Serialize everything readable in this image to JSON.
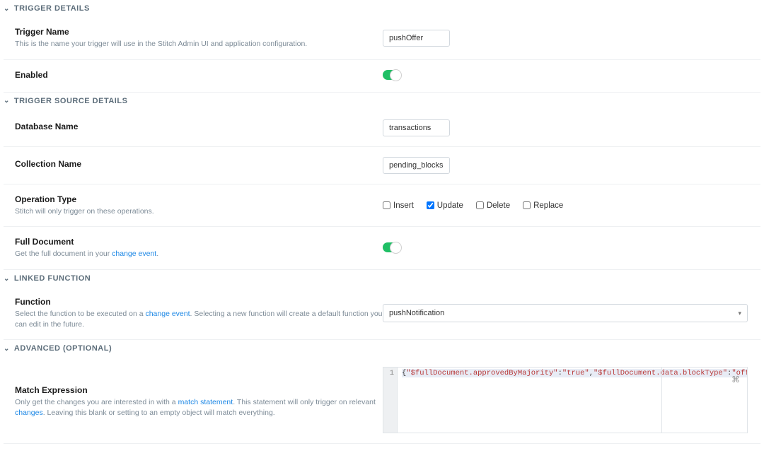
{
  "sections": {
    "trigger_details": {
      "title": "TRIGGER DETAILS"
    },
    "trigger_source_details": {
      "title": "TRIGGER SOURCE DETAILS"
    },
    "linked_function": {
      "title": "LINKED FUNCTION"
    },
    "advanced": {
      "title": "ADVANCED (OPTIONAL)"
    }
  },
  "triggerName": {
    "label": "Trigger Name",
    "hint": "This is the name your trigger will use in the Stitch Admin UI and application configuration.",
    "value": "pushOffer"
  },
  "enabled": {
    "label": "Enabled",
    "value": true
  },
  "databaseName": {
    "label": "Database Name",
    "value": "transactions"
  },
  "collectionName": {
    "label": "Collection Name",
    "value": "pending_blocks"
  },
  "operationType": {
    "label": "Operation Type",
    "hint": "Stitch will only trigger on these operations.",
    "options": [
      {
        "name": "Insert",
        "checked": false
      },
      {
        "name": "Update",
        "checked": true
      },
      {
        "name": "Delete",
        "checked": false
      },
      {
        "name": "Replace",
        "checked": false
      }
    ]
  },
  "fullDocument": {
    "label": "Full Document",
    "hint_prefix": "Get the full document in your ",
    "hint_link": "change event",
    "hint_suffix": ".",
    "value": true
  },
  "function": {
    "label": "Function",
    "hint_prefix": "Select the function to be executed on a ",
    "hint_link": "change event",
    "hint_suffix": ". Selecting a new function will create a default function you can edit in the future.",
    "selected": "pushNotification"
  },
  "matchExpression": {
    "label": "Match Expression",
    "hint_prefix": "Only get the changes you are interested in with a ",
    "hint_link1": "match statement",
    "hint_mid": ". This statement will only trigger on relevant ",
    "hint_link2": "changes",
    "hint_suffix": ". Leaving this blank or setting to an empty object will match everything.",
    "code": {
      "line": "1",
      "open": "{",
      "k1": "\"$fullDocument.approvedByMajority\"",
      "v1": "\"true\"",
      "k2": "\"$fullDocument.data.blockType\"",
      "v2": "\"offer\"",
      "close": "}"
    }
  }
}
